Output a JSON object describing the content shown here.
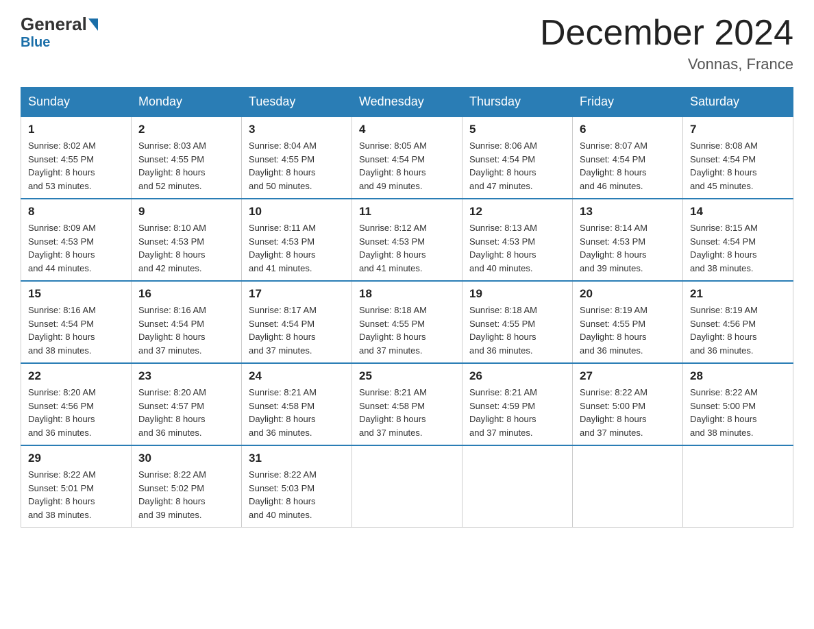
{
  "header": {
    "logo_general": "General",
    "logo_blue": "Blue",
    "month_title": "December 2024",
    "location": "Vonnas, France"
  },
  "days_of_week": [
    "Sunday",
    "Monday",
    "Tuesday",
    "Wednesday",
    "Thursday",
    "Friday",
    "Saturday"
  ],
  "weeks": [
    [
      {
        "day": "1",
        "sunrise": "8:02 AM",
        "sunset": "4:55 PM",
        "daylight": "8 hours and 53 minutes."
      },
      {
        "day": "2",
        "sunrise": "8:03 AM",
        "sunset": "4:55 PM",
        "daylight": "8 hours and 52 minutes."
      },
      {
        "day": "3",
        "sunrise": "8:04 AM",
        "sunset": "4:55 PM",
        "daylight": "8 hours and 50 minutes."
      },
      {
        "day": "4",
        "sunrise": "8:05 AM",
        "sunset": "4:54 PM",
        "daylight": "8 hours and 49 minutes."
      },
      {
        "day": "5",
        "sunrise": "8:06 AM",
        "sunset": "4:54 PM",
        "daylight": "8 hours and 47 minutes."
      },
      {
        "day": "6",
        "sunrise": "8:07 AM",
        "sunset": "4:54 PM",
        "daylight": "8 hours and 46 minutes."
      },
      {
        "day": "7",
        "sunrise": "8:08 AM",
        "sunset": "4:54 PM",
        "daylight": "8 hours and 45 minutes."
      }
    ],
    [
      {
        "day": "8",
        "sunrise": "8:09 AM",
        "sunset": "4:53 PM",
        "daylight": "8 hours and 44 minutes."
      },
      {
        "day": "9",
        "sunrise": "8:10 AM",
        "sunset": "4:53 PM",
        "daylight": "8 hours and 42 minutes."
      },
      {
        "day": "10",
        "sunrise": "8:11 AM",
        "sunset": "4:53 PM",
        "daylight": "8 hours and 41 minutes."
      },
      {
        "day": "11",
        "sunrise": "8:12 AM",
        "sunset": "4:53 PM",
        "daylight": "8 hours and 41 minutes."
      },
      {
        "day": "12",
        "sunrise": "8:13 AM",
        "sunset": "4:53 PM",
        "daylight": "8 hours and 40 minutes."
      },
      {
        "day": "13",
        "sunrise": "8:14 AM",
        "sunset": "4:53 PM",
        "daylight": "8 hours and 39 minutes."
      },
      {
        "day": "14",
        "sunrise": "8:15 AM",
        "sunset": "4:54 PM",
        "daylight": "8 hours and 38 minutes."
      }
    ],
    [
      {
        "day": "15",
        "sunrise": "8:16 AM",
        "sunset": "4:54 PM",
        "daylight": "8 hours and 38 minutes."
      },
      {
        "day": "16",
        "sunrise": "8:16 AM",
        "sunset": "4:54 PM",
        "daylight": "8 hours and 37 minutes."
      },
      {
        "day": "17",
        "sunrise": "8:17 AM",
        "sunset": "4:54 PM",
        "daylight": "8 hours and 37 minutes."
      },
      {
        "day": "18",
        "sunrise": "8:18 AM",
        "sunset": "4:55 PM",
        "daylight": "8 hours and 37 minutes."
      },
      {
        "day": "19",
        "sunrise": "8:18 AM",
        "sunset": "4:55 PM",
        "daylight": "8 hours and 36 minutes."
      },
      {
        "day": "20",
        "sunrise": "8:19 AM",
        "sunset": "4:55 PM",
        "daylight": "8 hours and 36 minutes."
      },
      {
        "day": "21",
        "sunrise": "8:19 AM",
        "sunset": "4:56 PM",
        "daylight": "8 hours and 36 minutes."
      }
    ],
    [
      {
        "day": "22",
        "sunrise": "8:20 AM",
        "sunset": "4:56 PM",
        "daylight": "8 hours and 36 minutes."
      },
      {
        "day": "23",
        "sunrise": "8:20 AM",
        "sunset": "4:57 PM",
        "daylight": "8 hours and 36 minutes."
      },
      {
        "day": "24",
        "sunrise": "8:21 AM",
        "sunset": "4:58 PM",
        "daylight": "8 hours and 36 minutes."
      },
      {
        "day": "25",
        "sunrise": "8:21 AM",
        "sunset": "4:58 PM",
        "daylight": "8 hours and 37 minutes."
      },
      {
        "day": "26",
        "sunrise": "8:21 AM",
        "sunset": "4:59 PM",
        "daylight": "8 hours and 37 minutes."
      },
      {
        "day": "27",
        "sunrise": "8:22 AM",
        "sunset": "5:00 PM",
        "daylight": "8 hours and 37 minutes."
      },
      {
        "day": "28",
        "sunrise": "8:22 AM",
        "sunset": "5:00 PM",
        "daylight": "8 hours and 38 minutes."
      }
    ],
    [
      {
        "day": "29",
        "sunrise": "8:22 AM",
        "sunset": "5:01 PM",
        "daylight": "8 hours and 38 minutes."
      },
      {
        "day": "30",
        "sunrise": "8:22 AM",
        "sunset": "5:02 PM",
        "daylight": "8 hours and 39 minutes."
      },
      {
        "day": "31",
        "sunrise": "8:22 AM",
        "sunset": "5:03 PM",
        "daylight": "8 hours and 40 minutes."
      },
      null,
      null,
      null,
      null
    ]
  ],
  "labels": {
    "sunrise": "Sunrise:",
    "sunset": "Sunset:",
    "daylight": "Daylight:"
  }
}
